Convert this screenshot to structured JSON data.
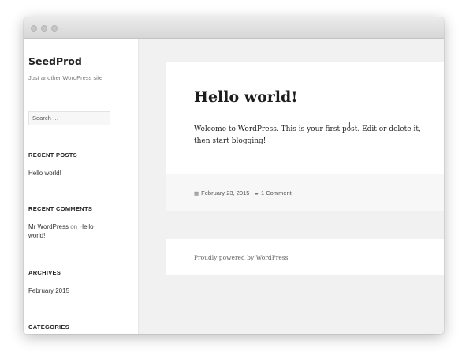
{
  "site": {
    "title": "SeedProd",
    "description": "Just another WordPress site"
  },
  "search": {
    "placeholder": "Search …"
  },
  "widgets": {
    "recent_posts": {
      "title": "RECENT POSTS",
      "items": [
        "Hello world!"
      ]
    },
    "recent_comments": {
      "title": "RECENT COMMENTS",
      "author": "Mr WordPress",
      "on": "on",
      "post": "Hello world!"
    },
    "archives": {
      "title": "ARCHIVES",
      "items": [
        "February 2015"
      ]
    },
    "categories": {
      "title": "CATEGORIES"
    }
  },
  "post": {
    "title": "Hello world!",
    "body": "Welcome to WordPress. This is your first post. Edit or delete it, then start blogging!",
    "date": "February 23, 2015",
    "comments": "1 Comment",
    "date_icon": "calendar-icon",
    "comment_icon": "comment-icon"
  },
  "footer": {
    "text": "Proudly powered by WordPress"
  }
}
